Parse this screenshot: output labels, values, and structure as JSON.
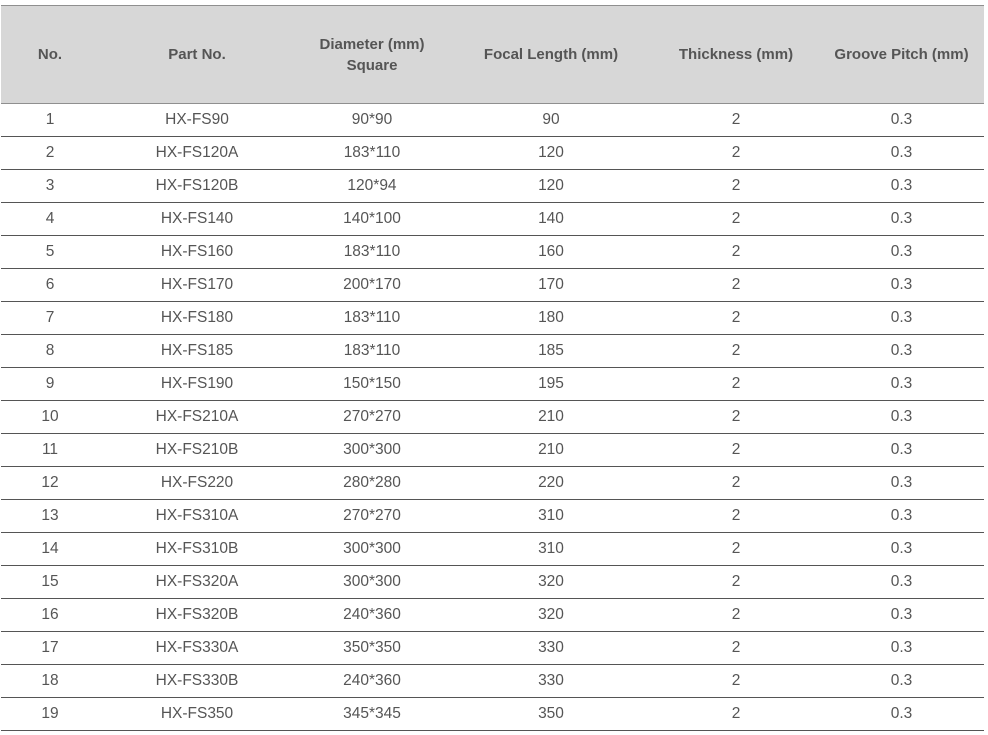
{
  "table": {
    "headers": [
      {
        "line1": "No.",
        "line2": ""
      },
      {
        "line1": "Part No.",
        "line2": ""
      },
      {
        "line1": "Diameter (mm)",
        "line2": "Square"
      },
      {
        "line1": "Focal Length (mm)",
        "line2": ""
      },
      {
        "line1": "Thickness (mm)",
        "line2": ""
      },
      {
        "line1": "Groove Pitch (mm)",
        "line2": ""
      }
    ],
    "rows": [
      [
        "1",
        "HX-FS90",
        "90*90",
        "90",
        "2",
        "0.3"
      ],
      [
        "2",
        "HX-FS120A",
        "183*110",
        "120",
        "2",
        "0.3"
      ],
      [
        "3",
        "HX-FS120B",
        "120*94",
        "120",
        "2",
        "0.3"
      ],
      [
        "4",
        "HX-FS140",
        "140*100",
        "140",
        "2",
        "0.3"
      ],
      [
        "5",
        "HX-FS160",
        "183*110",
        "160",
        "2",
        "0.3"
      ],
      [
        "6",
        "HX-FS170",
        "200*170",
        "170",
        "2",
        "0.3"
      ],
      [
        "7",
        "HX-FS180",
        "183*110",
        "180",
        "2",
        "0.3"
      ],
      [
        "8",
        "HX-FS185",
        "183*110",
        "185",
        "2",
        "0.3"
      ],
      [
        "9",
        "HX-FS190",
        "150*150",
        "195",
        "2",
        "0.3"
      ],
      [
        "10",
        "HX-FS210A",
        "270*270",
        "210",
        "2",
        "0.3"
      ],
      [
        "11",
        "HX-FS210B",
        "300*300",
        "210",
        "2",
        "0.3"
      ],
      [
        "12",
        "HX-FS220",
        "280*280",
        "220",
        "2",
        "0.3"
      ],
      [
        "13",
        "HX-FS310A",
        "270*270",
        "310",
        "2",
        "0.3"
      ],
      [
        "14",
        "HX-FS310B",
        "300*300",
        "310",
        "2",
        "0.3"
      ],
      [
        "15",
        "HX-FS320A",
        "300*300",
        "320",
        "2",
        "0.3"
      ],
      [
        "16",
        "HX-FS320B",
        "240*360",
        "320",
        "2",
        "0.3"
      ],
      [
        "17",
        "HX-FS330A",
        "350*350",
        "330",
        "2",
        "0.3"
      ],
      [
        "18",
        "HX-FS330B",
        "240*360",
        "330",
        "2",
        "0.3"
      ],
      [
        "19",
        "HX-FS350",
        "345*345",
        "350",
        "2",
        "0.3"
      ]
    ]
  },
  "colors": {
    "header_background": "#d7d7d7",
    "text": "#555555",
    "row_rule": "#555555"
  }
}
